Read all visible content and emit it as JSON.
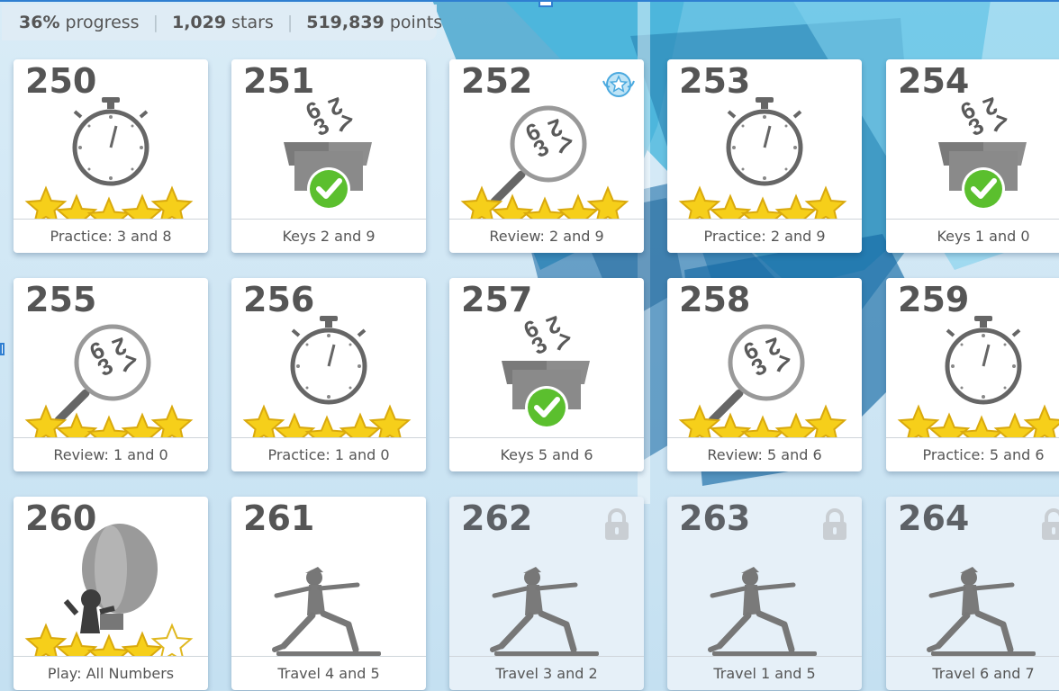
{
  "stats": {
    "progress_value": "36%",
    "progress_label": "progress",
    "stars_value": "1,029",
    "stars_label": "stars",
    "points_value": "519,839",
    "points_label": "points"
  },
  "lessons": [
    {
      "num": "250",
      "label": "Practice: 3 and 8",
      "type": "practice",
      "stars": 5,
      "locked": false
    },
    {
      "num": "251",
      "label": "Keys 2 and 9",
      "type": "keys",
      "stars": 0,
      "locked": false
    },
    {
      "num": "252",
      "label": "Review: 2 and 9",
      "type": "review",
      "stars": 5,
      "locked": false,
      "badge": true
    },
    {
      "num": "253",
      "label": "Practice: 2 and 9",
      "type": "practice",
      "stars": 5,
      "locked": false
    },
    {
      "num": "254",
      "label": "Keys 1 and 0",
      "type": "keys",
      "stars": 0,
      "locked": false
    },
    {
      "num": "255",
      "label": "Review: 1 and 0",
      "type": "review",
      "stars": 5,
      "locked": false
    },
    {
      "num": "256",
      "label": "Practice: 1 and 0",
      "type": "practice",
      "stars": 5,
      "locked": false
    },
    {
      "num": "257",
      "label": "Keys 5 and 6",
      "type": "keys",
      "stars": 0,
      "locked": false
    },
    {
      "num": "258",
      "label": "Review: 5 and 6",
      "type": "review",
      "stars": 5,
      "locked": false
    },
    {
      "num": "259",
      "label": "Practice: 5 and 6",
      "type": "practice",
      "stars": 5,
      "locked": false
    },
    {
      "num": "260",
      "label": "Play: All Numbers",
      "type": "play",
      "stars": 4,
      "locked": false
    },
    {
      "num": "261",
      "label": "Travel 4 and 5",
      "type": "travel",
      "stars": 0,
      "locked": false
    },
    {
      "num": "262",
      "label": "Travel 3 and 2",
      "type": "travel",
      "stars": 0,
      "locked": true
    },
    {
      "num": "263",
      "label": "Travel 1 and 5",
      "type": "travel",
      "stars": 0,
      "locked": true
    },
    {
      "num": "264",
      "label": "Travel 6 and 7",
      "type": "travel",
      "stars": 0,
      "locked": true
    }
  ],
  "keycap_digits": [
    "6",
    "2",
    "3",
    "7"
  ],
  "colors": {
    "star": "#f6cf1a",
    "check": "#5bbf2e",
    "accent": "#2f7fd1"
  },
  "icons": {
    "practice": "stopwatch-icon",
    "keys": "number-box-icon",
    "review": "magnifier-icon",
    "play": "balloon-icon",
    "travel": "yoga-pose-icon",
    "lock": "lock-icon",
    "badge": "star-badge-icon"
  }
}
